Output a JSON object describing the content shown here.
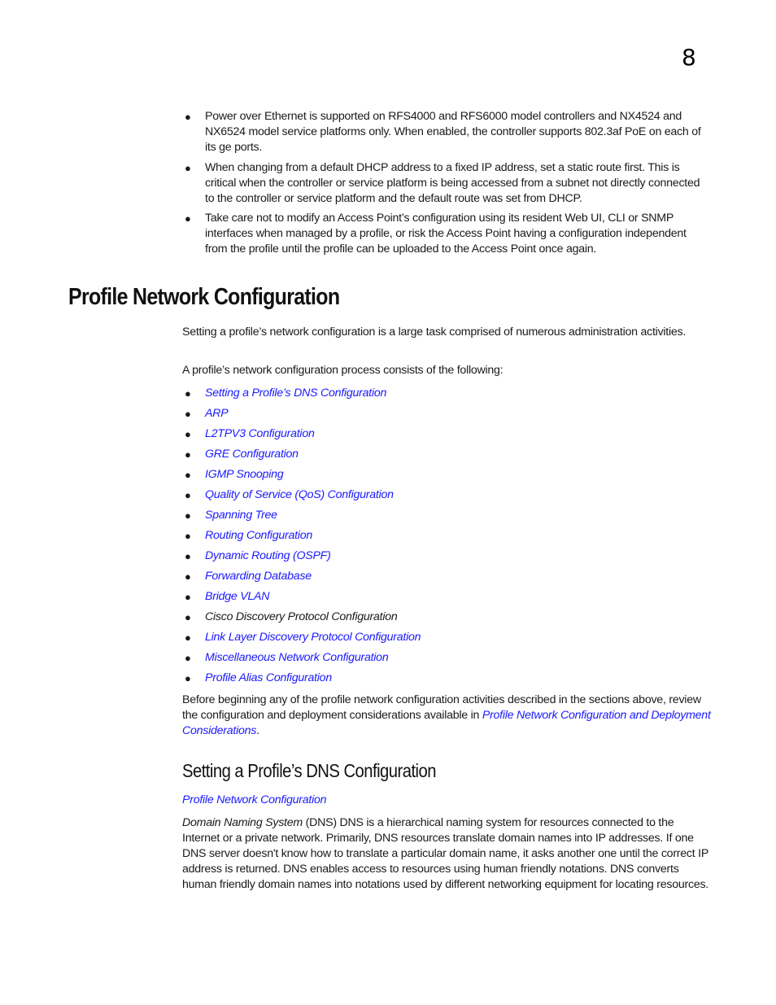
{
  "chapter_number": "8",
  "intro_bullets": [
    "Power over Ethernet is supported on RFS4000 and RFS6000 model controllers and NX4524 and NX6524 model service platforms only. When enabled, the controller supports 802.3af PoE on each of its ge ports.",
    "When changing from a default DHCP address to a fixed IP address, set a static route first. This is critical when the controller or service platform is being accessed from a subnet not directly connected to the controller or service platform and the default route was set from DHCP.",
    "Take care not to modify an Access Point’s configuration using its resident Web UI, CLI or SNMP interfaces when managed by a profile, or risk the Access Point having a configuration independent from the profile until the profile can be uploaded to the Access Point once again."
  ],
  "section": {
    "title": "Profile Network Configuration",
    "intro_para": "Setting a profile’s network configuration is a large task comprised of numerous administration activities.",
    "list_intro": "A profile’s network configuration process consists of the following:",
    "items": [
      {
        "label": "Setting a Profile’s DNS Configuration",
        "link": true
      },
      {
        "label": "ARP",
        "link": true
      },
      {
        "label": "L2TPV3 Configuration",
        "link": true
      },
      {
        "label": "GRE Configuration",
        "link": true
      },
      {
        "label": "IGMP Snooping",
        "link": true
      },
      {
        "label": "Quality of Service (QoS) Configuration",
        "link": true
      },
      {
        "label": "Spanning Tree",
        "link": true
      },
      {
        "label": "Routing Configuration",
        "link": true
      },
      {
        "label": "Dynamic Routing (OSPF)",
        "link": true
      },
      {
        "label": "Forwarding Database",
        "link": true
      },
      {
        "label": "Bridge VLAN",
        "link": true
      },
      {
        "label": "Cisco Discovery Protocol Configuration",
        "link": false
      },
      {
        "label": "Link Layer Discovery Protocol Configuration",
        "link": true
      },
      {
        "label": "Miscellaneous Network Configuration",
        "link": true
      },
      {
        "label": "Profile Alias Configuration",
        "link": true
      }
    ],
    "closing_para_prefix": "Before beginning any of the profile network configuration activities described in the sections above, review the configuration and deployment considerations available in ",
    "closing_para_link": "Profile Network Configuration and Deployment Considerations",
    "closing_para_suffix": "."
  },
  "subsection": {
    "title": "Setting a Profile’s DNS Configuration",
    "breadcrumb_link": "Profile Network Configuration",
    "body_italic": "Domain Naming System",
    "body_text": " (DNS) DNS is a hierarchical naming system for resources connected to the Internet or a private network. Primarily, DNS resources translate domain names into IP addresses. If one DNS server doesn't know how to translate a particular domain name, it asks another one until the correct IP address is returned. DNS enables access to resources using human friendly notations. DNS converts human friendly domain names into notations used by different networking equipment for locating resources."
  }
}
